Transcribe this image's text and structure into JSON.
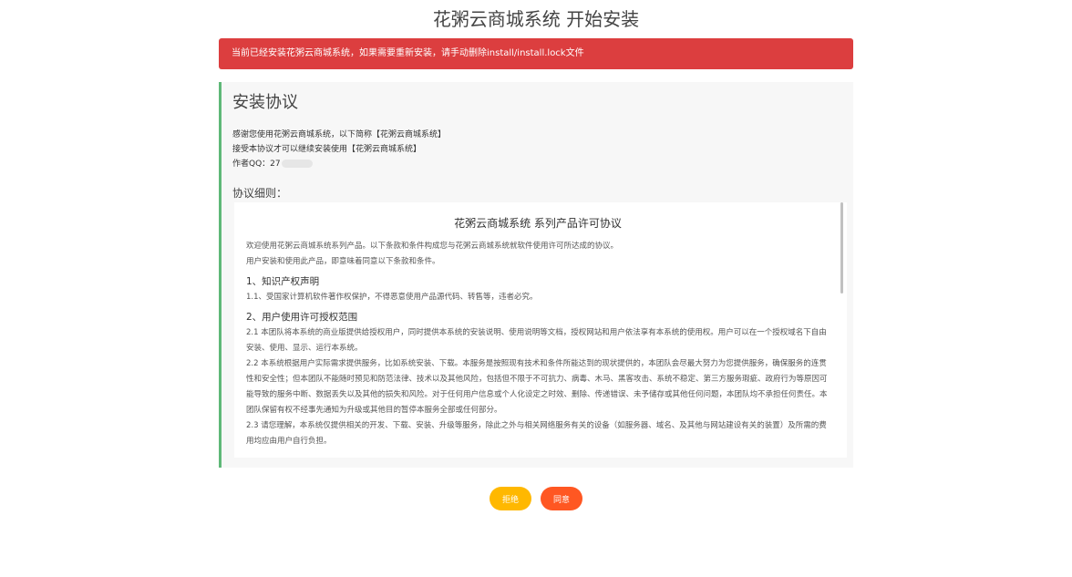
{
  "page": {
    "title": "花粥云商城系统 开始安装"
  },
  "alert": {
    "text": "当前已经安装花粥云商城系统，如果需要重新安装，请手动删除install/install.lock文件",
    "color": "#dc3e3f"
  },
  "agreement": {
    "heading": "安装协议",
    "intro": [
      "感谢您使用花粥云商城系统，以下简称【花粥云商城系统】",
      "接受本协议才可以继续安装使用【花粥云商城系统】"
    ],
    "author_label": "作者QQ：",
    "author_visible": "27",
    "details_label": "协议细则："
  },
  "license": {
    "title": "花粥云商城系统 系列产品许可协议",
    "paragraphs": [
      {
        "type": "p",
        "text": "欢迎使用花粥云商城系统系列产品。以下条款和条件构成您与花粥云商城系统就软件使用许可所达成的协议。"
      },
      {
        "type": "p",
        "text": "用户安装和使用此产品，即意味着同意以下条款和条件。"
      },
      {
        "type": "h",
        "text": "1、知识产权声明"
      },
      {
        "type": "p",
        "text": "1.1、受国家计算机软件著作权保护，不得恶意使用产品源代码、转售等，违者必究。"
      },
      {
        "type": "h",
        "text": "2、用户使用许可授权范围"
      },
      {
        "type": "p",
        "text": "2.1 本团队将本系统的商业版提供给授权用户，同时提供本系统的安装说明、使用说明等文档，授权网站和用户依法享有本系统的使用权。用户可以在一个授权域名下自由安装、使用、显示、运行本系统。"
      },
      {
        "type": "p",
        "text": "2.2 本系统根据用户实际需求提供服务，比如系统安装、下载。本服务是按照现有技术和条件所能达到的现状提供的，本团队会尽最大努力为您提供服务，确保服务的连贯性和安全性；但本团队不能随时预见和防范法律、技术以及其他风险，包括但不限于不可抗力、病毒、木马、黑客攻击、系统不稳定、第三方服务瑕疵、政府行为等原因可能导致的服务中断、数据丢失以及其他的损失和风险。对于任何用户信息或个人化设定之时效、删除、传递错误、未予储存或其他任何问题，本团队均不承担任何责任。本团队保留有权不经事先通知为升级或其他目的暂停本服务全部或任何部分。"
      },
      {
        "type": "p",
        "text": "2.3 请您理解，本系统仅提供相关的开发、下载、安装、升级等服务，除此之外与相关网络服务有关的设备（如服务器、域名、及其他与网站建设有关的装置）及所需的费用均应由用户自行负担。"
      }
    ]
  },
  "buttons": {
    "reject_label": "拒绝",
    "agree_label": "同意",
    "reject_color": "#ffb800",
    "agree_color": "#ff5722"
  }
}
